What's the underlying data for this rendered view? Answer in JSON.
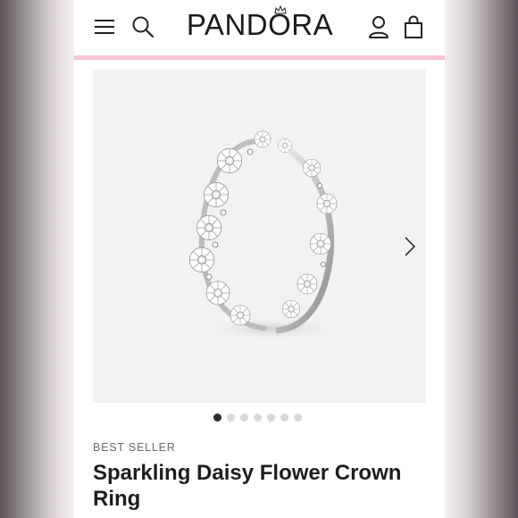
{
  "header": {
    "brand": "PANDORA",
    "menu_icon": "hamburger-menu-icon",
    "search_icon": "search-icon",
    "account_icon": "user-account-icon",
    "bag_icon": "shopping-bag-icon"
  },
  "gallery": {
    "image_alt": "Sparkling Daisy Flower Crown Ring product image",
    "next_icon": "chevron-right-icon",
    "slide_count": 7,
    "active_slide": 1
  },
  "product": {
    "badge": "BEST SELLER",
    "title": "Sparkling Daisy Flower Crown Ring"
  },
  "colors": {
    "accent_stripe": "#f7c5d1",
    "text": "#1e1e1e",
    "panel_bg": "#f2f2f2"
  }
}
